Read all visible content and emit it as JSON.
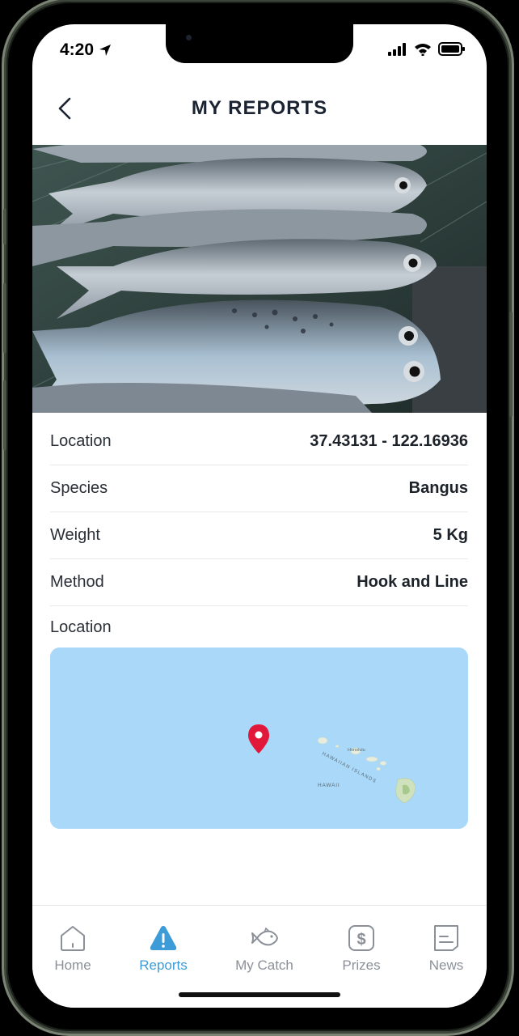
{
  "status_bar": {
    "time": "4:20"
  },
  "header": {
    "title": "MY REPORTS"
  },
  "details": [
    {
      "label": "Location",
      "value": "37.43131 - 122.16936"
    },
    {
      "label": "Species",
      "value": "Bangus"
    },
    {
      "label": "Weight",
      "value": "5 Kg"
    },
    {
      "label": "Method",
      "value": "Hook and Line"
    }
  ],
  "map_section": {
    "label": "Location",
    "map_labels": {
      "honolulu": "Honolulu",
      "islands": "HAWAIIAN ISLANDS",
      "hawaii": "HAWAII"
    }
  },
  "tabs": [
    {
      "label": "Home",
      "icon": "home-icon"
    },
    {
      "label": "Reports",
      "icon": "alert-icon",
      "active": true
    },
    {
      "label": "My Catch",
      "icon": "fish-icon"
    },
    {
      "label": "Prizes",
      "icon": "dollar-icon"
    },
    {
      "label": "News",
      "icon": "news-icon"
    }
  ],
  "colors": {
    "accent": "#3d9bd8",
    "pin": "#e2183a",
    "map_water": "#a9d8f8"
  }
}
